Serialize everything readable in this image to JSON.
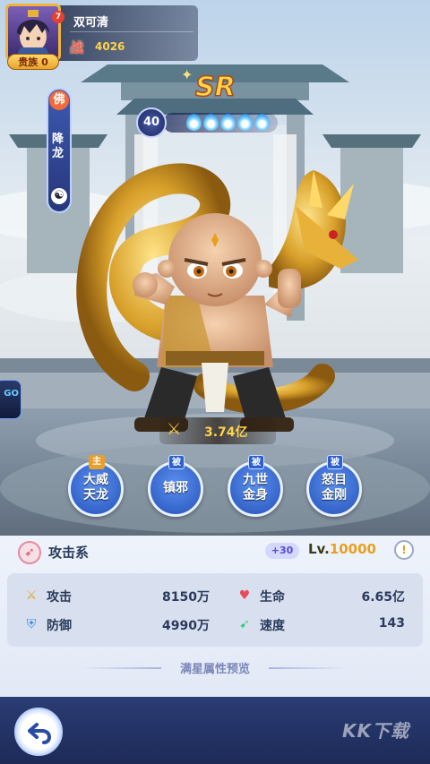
{
  "player": {
    "name": "双可清",
    "vip_label": "贵族 0",
    "badge": "7",
    "power_icon": "战",
    "power_value": "4026"
  },
  "hero": {
    "grade": "SR",
    "star_level": "40",
    "star_drops": 5,
    "faction_icon": "佛",
    "name": "降龙",
    "yinyang_icon": "☯",
    "combat_power_icon": "⚔",
    "combat_power": "3.74亿"
  },
  "skills": [
    {
      "tag": "主",
      "tag_type": "main",
      "line1": "大威",
      "line2": "天龙"
    },
    {
      "tag": "被",
      "tag_type": "passive",
      "line1": "镇邪",
      "line2": ""
    },
    {
      "tag": "被",
      "tag_type": "passive",
      "line1": "九世",
      "line2": "金身"
    },
    {
      "tag": "被",
      "tag_type": "passive",
      "line1": "怒目",
      "line2": "金刚"
    }
  ],
  "info": {
    "type_icon": "attack-icon",
    "type_label": "攻击系",
    "bonus": "+30",
    "level_prefix": "Lv.",
    "level_value": "10000",
    "level_btn": "!"
  },
  "stats": [
    {
      "icon": "sword-icon",
      "label": "攻击",
      "value": "8150万",
      "color": "#e8a020"
    },
    {
      "icon": "heart-icon",
      "label": "生命",
      "value": "6.65亿",
      "color": "#e84a5a"
    },
    {
      "icon": "shield-icon",
      "label": "防御",
      "value": "4990万",
      "color": "#3a8ae8"
    },
    {
      "icon": "boot-icon",
      "label": "速度",
      "value": "143",
      "color": "#3ac87a"
    }
  ],
  "preview_label": "满星属性预览",
  "watermark": "KK下载",
  "float_icon_text": "GO"
}
